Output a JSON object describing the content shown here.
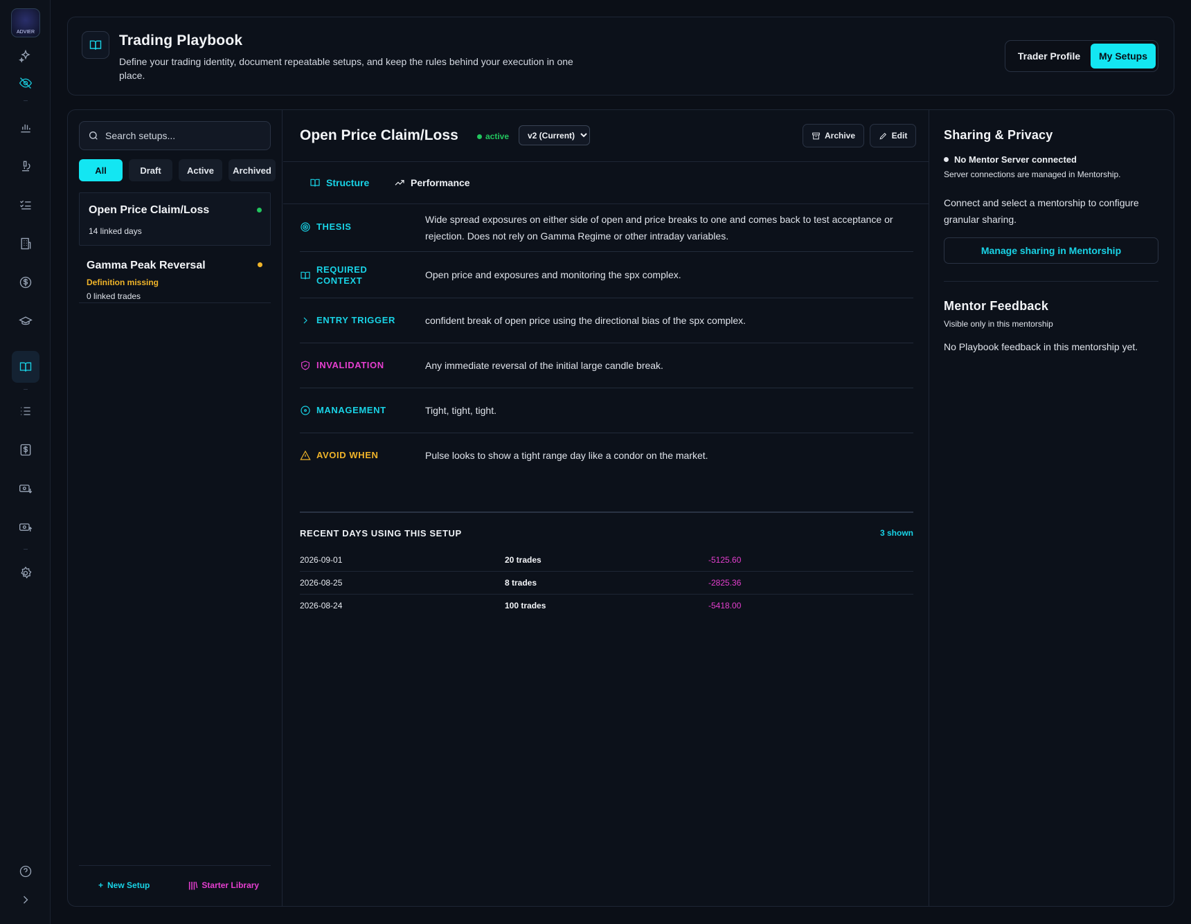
{
  "rail": {
    "logo_text": "ADVIER",
    "icons": [
      "sparkles-icon",
      "eye-off-icon",
      "chart-icon",
      "microscope-icon",
      "checklist-icon",
      "building-icon",
      "dollar-circle-icon",
      "graduation-cap-icon",
      "book-open-icon",
      "list-icon",
      "dollar-square-icon",
      "money-in-icon",
      "money-out-icon",
      "settings-icon",
      "help-icon",
      "chevron-right-icon"
    ],
    "active": "book-open-icon"
  },
  "header": {
    "title": "Trading Playbook",
    "description": "Define your trading identity, document repeatable setups, and keep the rules behind your execution in one place.",
    "toggle": [
      "Trader Profile",
      "My Setups"
    ],
    "toggle_active": "My Setups"
  },
  "list": {
    "search_placeholder": "Search setups...",
    "filters": [
      "All",
      "Draft",
      "Active",
      "Archived"
    ],
    "active_filter": "All",
    "setups": [
      {
        "name": "Open Price Claim/Loss",
        "meta": "14 linked days",
        "status_color": "#22c55e"
      },
      {
        "name": "Gamma Peak Reversal",
        "warning": "Definition missing",
        "meta": "0 linked trades",
        "status_color": "#f0b429"
      }
    ],
    "new_setup": "New Setup",
    "starter_library": "Starter Library"
  },
  "detail": {
    "title": "Open Price Claim/Loss",
    "status": "active",
    "version": "v2 (Current)",
    "archive": "Archive",
    "edit": "Edit",
    "tabs": [
      "Structure",
      "Performance"
    ],
    "sections": {
      "thesis": {
        "label": "THESIS",
        "text": "Wide spread exposures on either side of open and price breaks to one and comes back to test acceptance or rejection. Does not rely on Gamma Regime or other intraday variables."
      },
      "context": {
        "label_1": "REQUIRED",
        "label_2": "CONTEXT",
        "text": "Open price and exposures and monitoring the spx complex."
      },
      "entry": {
        "label": "ENTRY TRIGGER",
        "text": "confident break of open price using the directional bias of the spx complex."
      },
      "invalidation": {
        "label": "INVALIDATION",
        "text": "Any immediate reversal of the initial large candle break."
      },
      "management": {
        "label": "MANAGEMENT",
        "text": "Tight, tight, tight."
      },
      "avoid": {
        "label": "AVOID WHEN",
        "text": "Pulse looks to show a tight range day like a condor on the market."
      }
    },
    "recent": {
      "heading": "RECENT DAYS USING THIS SETUP",
      "count": "3 shown",
      "rows": [
        {
          "date": "2026-09-01",
          "trades": "20 trades",
          "pnl": "-5125.60"
        },
        {
          "date": "2026-08-25",
          "trades": "8 trades",
          "pnl": "-2825.36"
        },
        {
          "date": "2026-08-24",
          "trades": "100 trades",
          "pnl": "-5418.00"
        }
      ]
    }
  },
  "side": {
    "sharing_title": "Sharing & Privacy",
    "server_status": "No Mentor Server connected",
    "server_note": "Server connections are managed in Mentorship.",
    "connect_text": "Connect and select a mentorship to configure granular sharing.",
    "manage_button": "Manage sharing in Mentorship",
    "feedback_title": "Mentor Feedback",
    "feedback_note": "Visible only in this mentorship",
    "feedback_empty": "No Playbook feedback in this mentorship yet."
  },
  "colors": {
    "accent": "#13e6f2",
    "magenta": "#e63fd0",
    "amber": "#f0b429",
    "green": "#22c55e",
    "background": "#0b0f17"
  }
}
